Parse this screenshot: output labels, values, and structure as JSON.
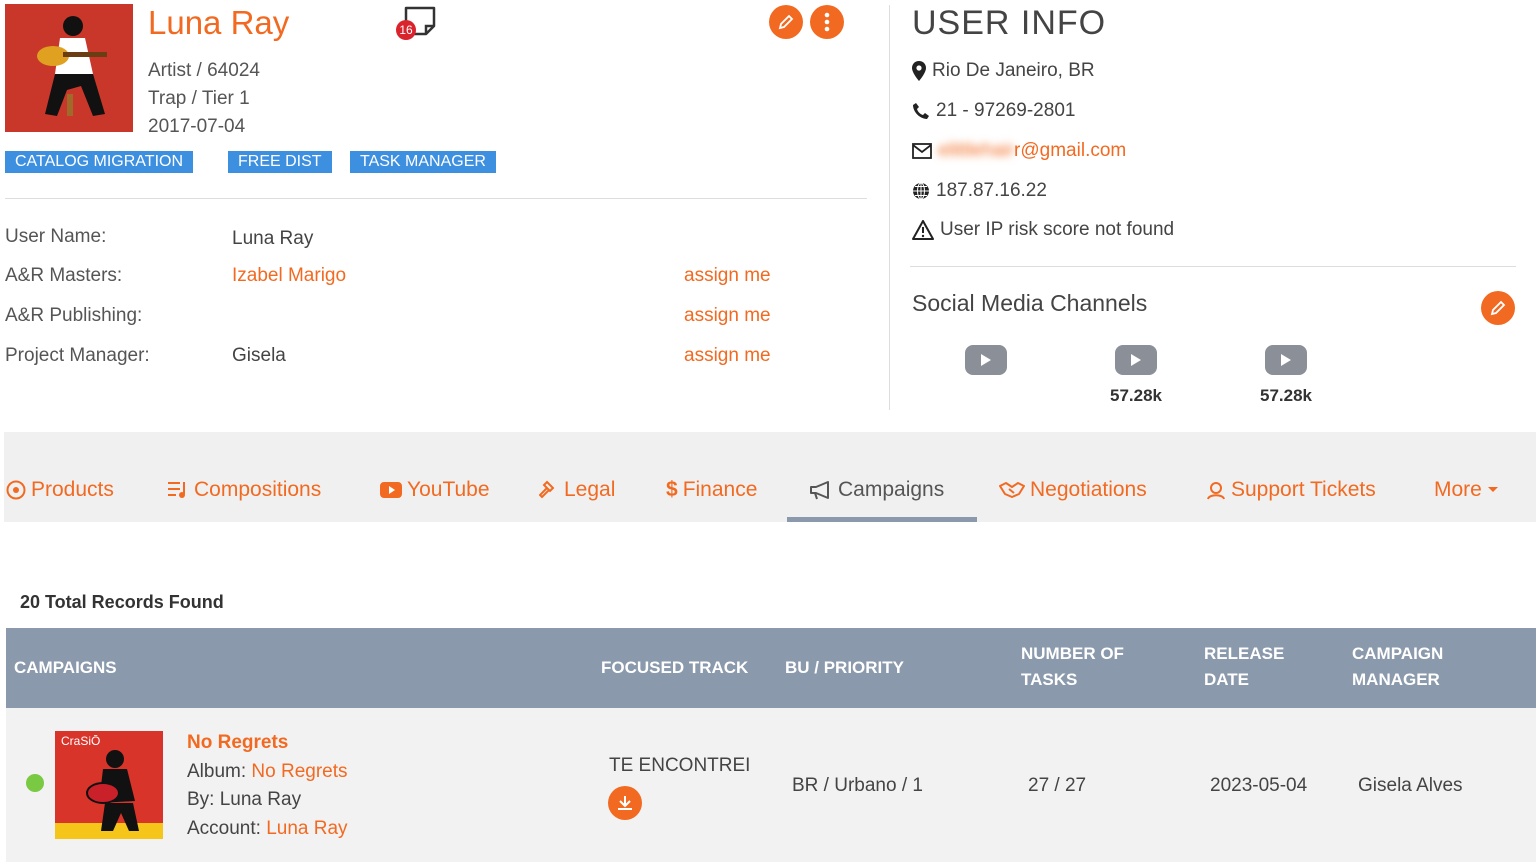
{
  "artist": {
    "name": "Luna Ray",
    "type_id": "Artist / 64024",
    "genre_tier": "Trap / Tier 1",
    "date": "2017-07-04",
    "notes_count": "16",
    "tags": [
      "CATALOG MIGRATION",
      "FREE DIST",
      "TASK MANAGER"
    ]
  },
  "details": {
    "user_name_label": "User Name:",
    "user_name_value": "Luna Ray",
    "ar_masters_label": "A&R Masters:",
    "ar_masters_value": "Izabel Marigo",
    "ar_publishing_label": "A&R Publishing:",
    "project_manager_label": "Project Manager:",
    "project_manager_value": "Gisela",
    "assign_label": "assign me"
  },
  "user_info": {
    "title": "USER INFO",
    "location": "Rio De Janeiro, BR",
    "phone": "21 - 97269-2801",
    "email_blurred": "elittlehair",
    "email_domain": "r@gmail.com",
    "ip": "187.87.16.22",
    "risk": "User IP risk score not found"
  },
  "social": {
    "title": "Social Media Channels",
    "channels": [
      {
        "icon": "youtube-icon",
        "count": ""
      },
      {
        "icon": "youtube-icon",
        "count": "57.28k"
      },
      {
        "icon": "youtube-icon",
        "count": "57.28k"
      }
    ]
  },
  "tabs": [
    "Products",
    "Compositions",
    "YouTube",
    "Legal",
    "Finance",
    "Campaigns",
    "Negotiations",
    "Support Tickets",
    "More"
  ],
  "active_tab": "Campaigns",
  "records_label": "20 Total Records Found",
  "table": {
    "headers": [
      "CAMPAIGNS",
      "FOCUSED TRACK",
      "BU / PRIORITY",
      "NUMBER OF TASKS",
      "RELEASE DATE",
      "CAMPAIGN MANAGER"
    ],
    "rows": [
      {
        "status_color": "#7ac943",
        "cover_text": "CraSiŌ",
        "title": "No Regrets",
        "album_label": "Album:",
        "album": "No Regrets",
        "by_label": "By:",
        "by": "Luna Ray",
        "account_label": "Account:",
        "account": "Luna Ray",
        "focused_track": "TE ENCONTREI",
        "bu_priority": "BR / Urbano / 1",
        "tasks": "27 / 27",
        "release_date": "2023-05-04",
        "manager": "Gisela Alves"
      }
    ]
  },
  "colors": {
    "accent": "#f26a21",
    "tag": "#3d8fe0",
    "header": "#8a99ab"
  }
}
